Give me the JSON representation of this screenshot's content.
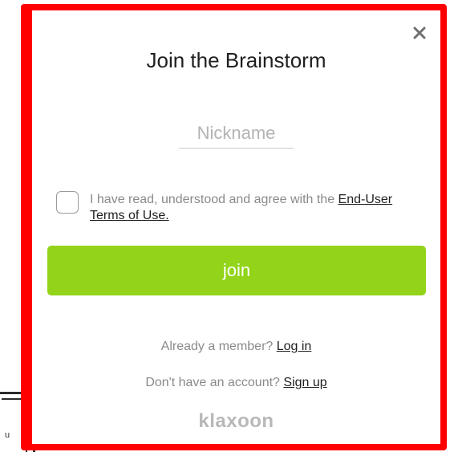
{
  "background": {
    "fragment_letter": "u"
  },
  "modal": {
    "title": "Join the Brainstorm",
    "close_icon": "close-icon",
    "nickname": {
      "placeholder": "Nickname",
      "value": ""
    },
    "terms": {
      "prefix": "I have read, understood and agree with the ",
      "link": "End-User Terms of Use."
    },
    "join_label": "join",
    "login": {
      "prompt": "Already a member? ",
      "link": "Log in"
    },
    "signup": {
      "prompt": "Don't have an account? ",
      "link": "Sign up"
    },
    "brand": "klaxoon"
  },
  "colors": {
    "highlight": "#ff0000",
    "join_button": "#93d41a",
    "muted_text": "#8a8a8a",
    "brand": "#b8b8b8"
  }
}
